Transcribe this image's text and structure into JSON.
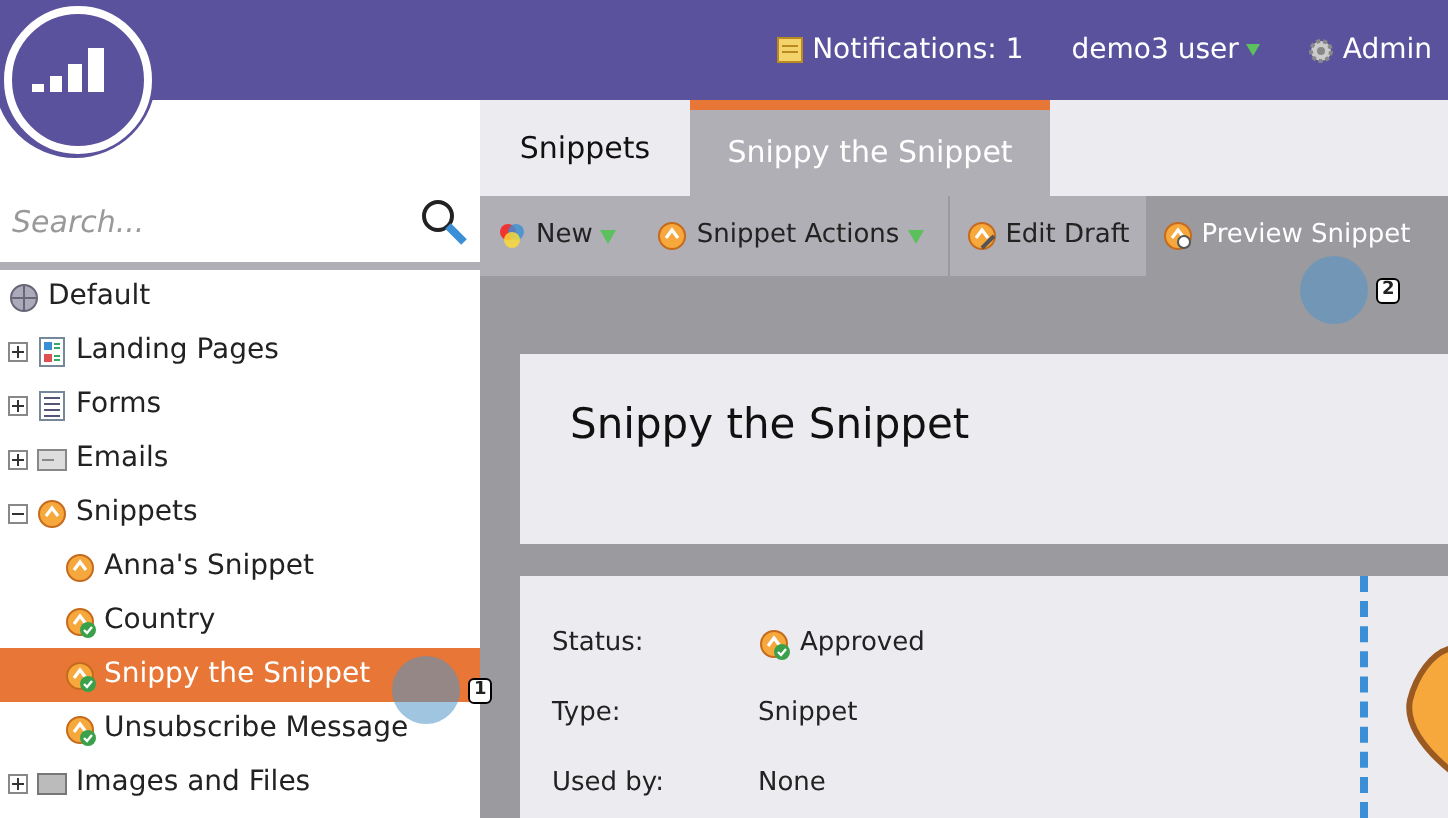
{
  "header": {
    "notifications": "Notifications: 1",
    "user": "demo3 user",
    "admin": "Admin"
  },
  "search": {
    "placeholder": "Search..."
  },
  "tree": [
    {
      "label": "Default",
      "kind": "globe"
    },
    {
      "label": "Landing Pages",
      "kind": "page",
      "expanded": false
    },
    {
      "label": "Forms",
      "kind": "form",
      "expanded": false
    },
    {
      "label": "Emails",
      "kind": "email",
      "expanded": false
    },
    {
      "label": "Snippets",
      "kind": "snippet",
      "expanded": true,
      "children": [
        {
          "label": "Anna's Snippet",
          "approved": false,
          "selected": false
        },
        {
          "label": "Country",
          "approved": true,
          "selected": false
        },
        {
          "label": "Snippy the Snippet",
          "approved": true,
          "selected": true
        },
        {
          "label": "Unsubscribe Message",
          "approved": true,
          "selected": false
        }
      ]
    },
    {
      "label": "Images and Files",
      "kind": "image",
      "expanded": false
    }
  ],
  "tabs": [
    {
      "label": "Snippets",
      "selected": false
    },
    {
      "label": "Snippy the Snippet",
      "selected": true
    }
  ],
  "toolbar": [
    {
      "label": "New",
      "kind": "new",
      "dropdown": true,
      "hovered": false
    },
    {
      "label": "Snippet Actions",
      "kind": "snippet",
      "dropdown": true,
      "hovered": false
    },
    {
      "label": "Edit Draft",
      "kind": "edit",
      "dropdown": false,
      "hovered": false
    },
    {
      "label": "Preview Snippet",
      "kind": "preview",
      "dropdown": false,
      "hovered": true
    }
  ],
  "title": "Snippy the Snippet",
  "details": [
    {
      "label": "Status:",
      "value": "Approved",
      "approved": true
    },
    {
      "label": "Type:",
      "value": "Snippet",
      "approved": false
    },
    {
      "label": "Used by:",
      "value": "None",
      "approved": false
    }
  ],
  "cursors": [
    {
      "label": "1"
    },
    {
      "label": "2"
    }
  ]
}
